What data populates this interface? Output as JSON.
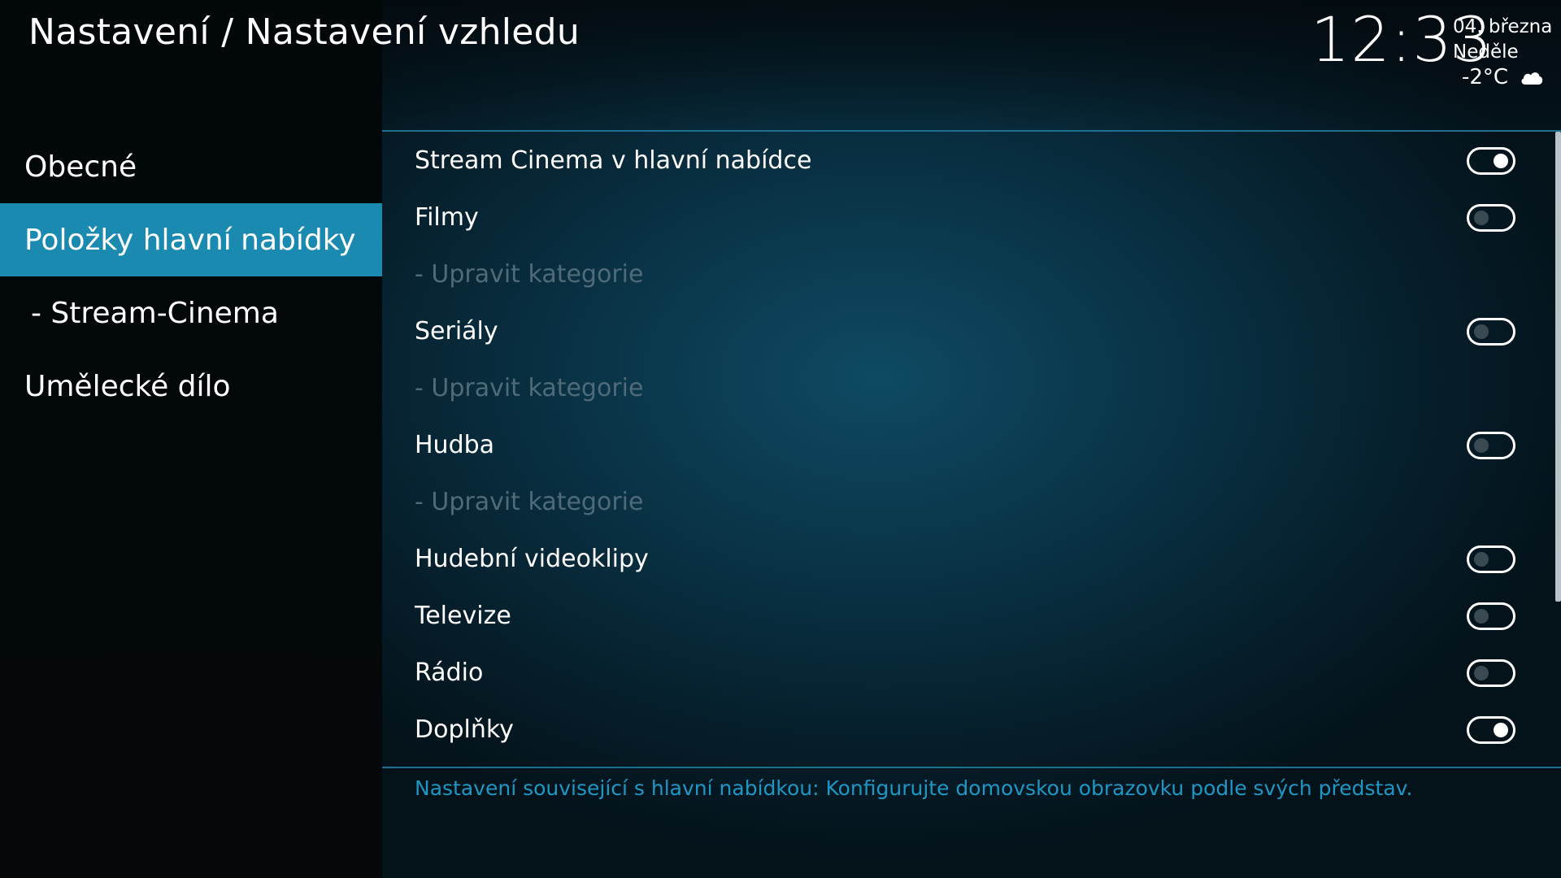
{
  "header": {
    "title": "Nastavení / Nastavení vzhledu",
    "clock": "12:33",
    "date": "04. března",
    "day": "Neděle",
    "temperature": "-2°C",
    "weather_icon": "cloud-icon"
  },
  "sidebar": {
    "items": [
      {
        "label": "Obecné",
        "active": false
      },
      {
        "label": "Položky hlavní nabídky",
        "active": true
      },
      {
        "label": "- Stream-Cinema",
        "active": false
      },
      {
        "label": "Umělecké dílo",
        "active": false
      }
    ]
  },
  "settings": {
    "rows": [
      {
        "label": "Stream Cinema v hlavní nabídce",
        "toggle": true
      },
      {
        "label": "Filmy",
        "toggle": false
      },
      {
        "label": "- Upravit kategorie",
        "disabled": true
      },
      {
        "label": "Seriály",
        "toggle": false
      },
      {
        "label": "- Upravit kategorie",
        "disabled": true
      },
      {
        "label": "Hudba",
        "toggle": false
      },
      {
        "label": "- Upravit kategorie",
        "disabled": true
      },
      {
        "label": "Hudební videoklipy",
        "toggle": false
      },
      {
        "label": "Televize",
        "toggle": false
      },
      {
        "label": "Rádio",
        "toggle": false
      },
      {
        "label": "Doplňky",
        "toggle": true
      }
    ]
  },
  "description": "Nastavení související s hlavní nabídkou: Konfigurujte domovskou obrazovku podle svých představ.",
  "colors": {
    "accent": "#1a8ab0",
    "description_text": "#1f97c4",
    "disabled_text": "#4f6b78"
  }
}
